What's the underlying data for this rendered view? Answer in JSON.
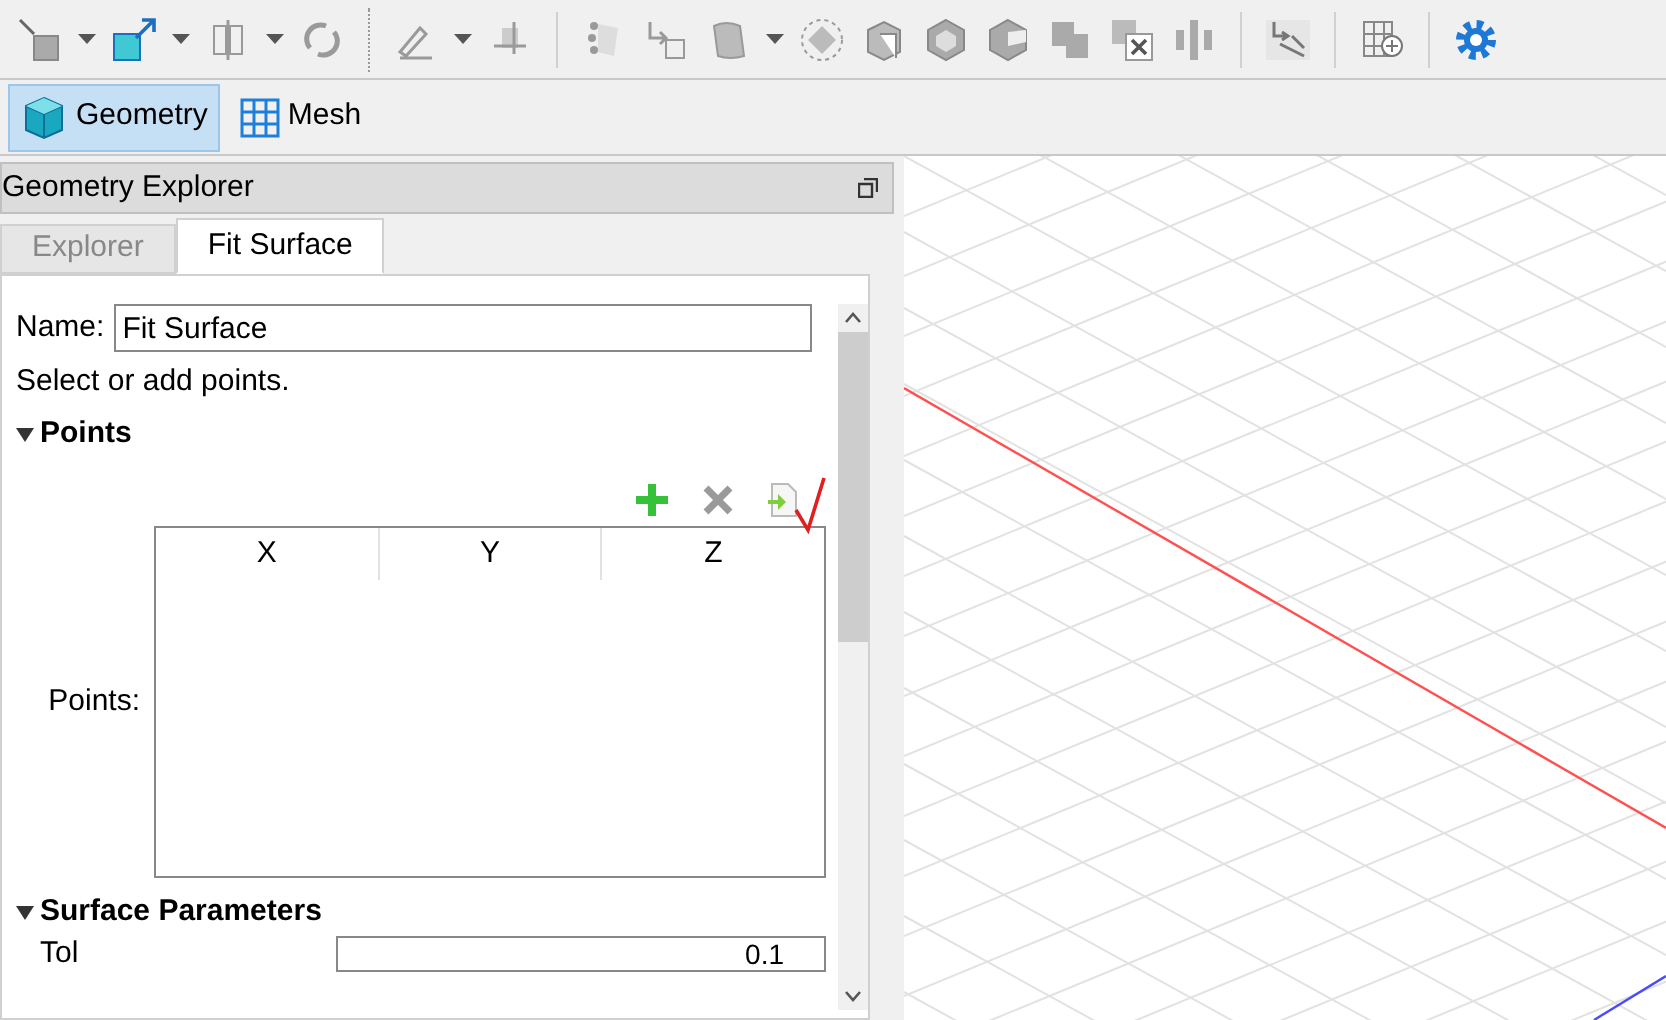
{
  "mode_tabs": [
    {
      "label": "Geometry",
      "selected": true
    },
    {
      "label": "Mesh",
      "selected": false
    }
  ],
  "panel": {
    "title": "Geometry Explorer",
    "tabs": [
      {
        "label": "Explorer",
        "selected": false
      },
      {
        "label": "Fit Surface",
        "selected": true
      }
    ],
    "name_label": "Name:",
    "name_value": "Fit Surface",
    "hint": "Select or add points.",
    "points_section": {
      "title": "Points",
      "expanded": true,
      "field_label": "Points:",
      "columns": [
        "X",
        "Y",
        "Z"
      ]
    },
    "surface_section": {
      "title": "Surface Parameters",
      "expanded": true,
      "field_label": "Tol",
      "field_value": "0.1"
    }
  }
}
